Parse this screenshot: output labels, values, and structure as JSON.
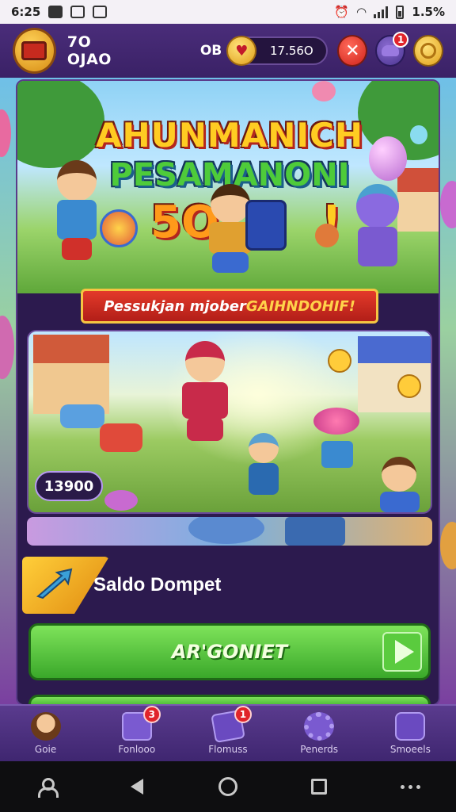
{
  "status_bar": {
    "time": "6:25",
    "battery": "1.5%",
    "icons": [
      "message-icon",
      "download-icon",
      "nfc-icon",
      "alarm-icon",
      "wifi-icon",
      "signal-icon",
      "battery-icon"
    ]
  },
  "hud": {
    "player_name": "7O OJAO",
    "level_label": "OB",
    "coins": "17.56O",
    "notification_count": "1",
    "icons": [
      "avatar-chest-icon",
      "coin-heart-icon",
      "close-icon",
      "mascot-icon",
      "gold-coin-icon"
    ]
  },
  "hero": {
    "title_line1": "AHUNMANICH",
    "title_line2": "PESAMANONI",
    "title_line3": "5O",
    "title_line3_suffix": "!",
    "ribbon_text": "Pessukjan mjober ",
    "ribbon_highlight": "GAIHNDOHIF!"
  },
  "scene": {
    "score": "13900"
  },
  "wallet": {
    "title": "Saldo Dompet",
    "icon": "wallet-arrow-icon"
  },
  "play_button": {
    "label": "AR'GONIET",
    "icon": "play-arrow-icon"
  },
  "bottom_nav": {
    "items": [
      {
        "label": "Goie",
        "icon": "avatar-nav-icon",
        "badge": ""
      },
      {
        "label": "Fonlooo",
        "icon": "box-icon",
        "badge": "3"
      },
      {
        "label": "Flomuss",
        "icon": "gift-icon",
        "badge": "1"
      },
      {
        "label": "Penerds",
        "icon": "gear-icon",
        "badge": ""
      },
      {
        "label": "Smoeels",
        "icon": "wallet-icon",
        "badge": ""
      }
    ]
  },
  "colors": {
    "hud_purple": "#4a2d7a",
    "panel_dark": "#2c1a4e",
    "play_green": "#3aa82a",
    "ribbon_red": "#e33a2a",
    "gold": "#f5c542"
  }
}
